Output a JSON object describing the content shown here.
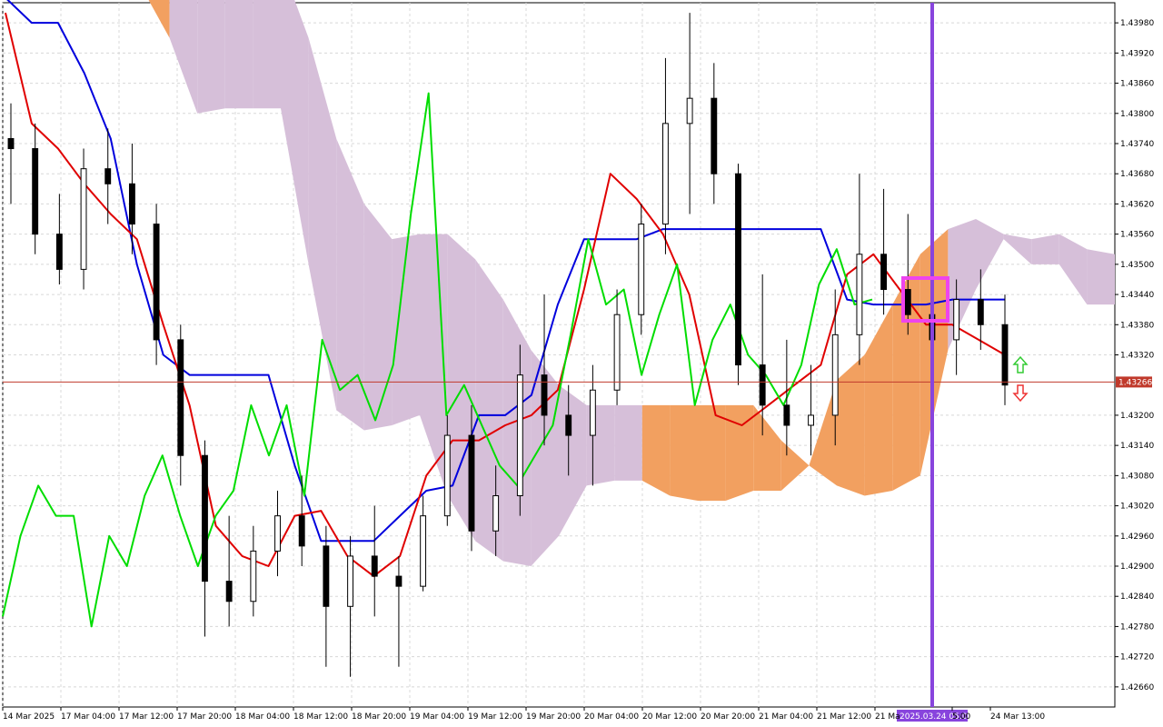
{
  "chart_data": {
    "type": "candlestick",
    "title": "",
    "xlabel": "",
    "ylabel": "",
    "ylim": [
      1.4262,
      1.4402
    ],
    "grid": true,
    "y_ticks": [
      "1.43980",
      "1.43920",
      "1.43860",
      "1.43800",
      "1.43740",
      "1.43680",
      "1.43620",
      "1.43560",
      "1.43500",
      "1.43440",
      "1.43380",
      "1.43320",
      "1.43200",
      "1.43140",
      "1.43080",
      "1.43020",
      "1.42960",
      "1.42900",
      "1.42840",
      "1.42780",
      "1.42720",
      "1.42660"
    ],
    "x_ticks": [
      "14 Mar 2025",
      "17 Mar 04:00",
      "17 Mar 12:00",
      "17 Mar 20:00",
      "18 Mar 04:00",
      "18 Mar 12:00",
      "18 Mar 20:00",
      "19 Mar 04:00",
      "19 Mar 12:00",
      "19 Mar 20:00",
      "20 Mar 04:00",
      "20 Mar 12:00",
      "20 Mar 20:00",
      "21 Mar 04:00",
      "21 Mar 12:00",
      "21 Ma",
      "5:00",
      "24 Mar 13:00"
    ],
    "current_price": "1.43266",
    "current_price_value": 1.43266,
    "vertical_marker_label": "2025.03.24 05:00",
    "colors": {
      "tenkan": "#e00000",
      "kijun": "#0000dd",
      "chikou": "#00dd00",
      "kumo_bear": "#d6bfd9",
      "kumo_bull": "#f2a060",
      "marker": "#8844dd",
      "highlight": "#ee44ee",
      "price_line": "#c0392b",
      "arrow_up": "#33cc33",
      "arrow_down": "#ee3333"
    },
    "candles": [
      {
        "o": 1.4375,
        "h": 1.4382,
        "l": 1.4362,
        "c": 1.4373
      },
      {
        "o": 1.4373,
        "h": 1.4378,
        "l": 1.4352,
        "c": 1.4356
      },
      {
        "o": 1.4356,
        "h": 1.4364,
        "l": 1.4346,
        "c": 1.4349
      },
      {
        "o": 1.4349,
        "h": 1.4373,
        "l": 1.4345,
        "c": 1.4369
      },
      {
        "o": 1.4369,
        "h": 1.4377,
        "l": 1.4358,
        "c": 1.4366
      },
      {
        "o": 1.4366,
        "h": 1.4374,
        "l": 1.4352,
        "c": 1.4358
      },
      {
        "o": 1.4358,
        "h": 1.4362,
        "l": 1.433,
        "c": 1.4335
      },
      {
        "o": 1.4335,
        "h": 1.4338,
        "l": 1.4306,
        "c": 1.4312
      },
      {
        "o": 1.4312,
        "h": 1.4315,
        "l": 1.4276,
        "c": 1.4287
      },
      {
        "o": 1.4287,
        "h": 1.43,
        "l": 1.4278,
        "c": 1.4283
      },
      {
        "o": 1.4283,
        "h": 1.4298,
        "l": 1.428,
        "c": 1.4293
      },
      {
        "o": 1.4293,
        "h": 1.4305,
        "l": 1.4288,
        "c": 1.43
      },
      {
        "o": 1.43,
        "h": 1.4308,
        "l": 1.429,
        "c": 1.4294
      },
      {
        "o": 1.4294,
        "h": 1.4298,
        "l": 1.427,
        "c": 1.4282
      },
      {
        "o": 1.4282,
        "h": 1.4296,
        "l": 1.4268,
        "c": 1.4292
      },
      {
        "o": 1.4292,
        "h": 1.4302,
        "l": 1.428,
        "c": 1.4288
      },
      {
        "o": 1.4288,
        "h": 1.4292,
        "l": 1.427,
        "c": 1.4286
      },
      {
        "o": 1.4286,
        "h": 1.4304,
        "l": 1.4285,
        "c": 1.43
      },
      {
        "o": 1.43,
        "h": 1.432,
        "l": 1.4298,
        "c": 1.4316
      },
      {
        "o": 1.4316,
        "h": 1.4322,
        "l": 1.4293,
        "c": 1.4297
      },
      {
        "o": 1.4297,
        "h": 1.431,
        "l": 1.4292,
        "c": 1.4304
      },
      {
        "o": 1.4304,
        "h": 1.4334,
        "l": 1.43,
        "c": 1.4328
      },
      {
        "o": 1.4328,
        "h": 1.4344,
        "l": 1.4314,
        "c": 1.432
      },
      {
        "o": 1.432,
        "h": 1.4326,
        "l": 1.4308,
        "c": 1.4316
      },
      {
        "o": 1.4316,
        "h": 1.433,
        "l": 1.4306,
        "c": 1.4325
      },
      {
        "o": 1.4325,
        "h": 1.4345,
        "l": 1.4322,
        "c": 1.434
      },
      {
        "o": 1.434,
        "h": 1.4362,
        "l": 1.4336,
        "c": 1.4358
      },
      {
        "o": 1.4358,
        "h": 1.4391,
        "l": 1.4352,
        "c": 1.4378
      },
      {
        "o": 1.4378,
        "h": 1.44,
        "l": 1.436,
        "c": 1.4383
      },
      {
        "o": 1.4383,
        "h": 1.439,
        "l": 1.4362,
        "c": 1.4368
      },
      {
        "o": 1.4368,
        "h": 1.437,
        "l": 1.4326,
        "c": 1.433
      },
      {
        "o": 1.433,
        "h": 1.4348,
        "l": 1.4316,
        "c": 1.4322
      },
      {
        "o": 1.4322,
        "h": 1.4335,
        "l": 1.4312,
        "c": 1.4318
      },
      {
        "o": 1.4318,
        "h": 1.433,
        "l": 1.4312,
        "c": 1.432
      },
      {
        "o": 1.432,
        "h": 1.4345,
        "l": 1.4314,
        "c": 1.4336
      },
      {
        "o": 1.4336,
        "h": 1.4368,
        "l": 1.433,
        "c": 1.4352
      },
      {
        "o": 1.4352,
        "h": 1.4365,
        "l": 1.434,
        "c": 1.4345
      },
      {
        "o": 1.4345,
        "h": 1.436,
        "l": 1.4336,
        "c": 1.434
      },
      {
        "o": 1.434,
        "h": 1.4352,
        "l": 1.433,
        "c": 1.4335
      },
      {
        "o": 1.4335,
        "h": 1.4347,
        "l": 1.4328,
        "c": 1.4343
      },
      {
        "o": 1.4343,
        "h": 1.4349,
        "l": 1.4333,
        "c": 1.4338
      },
      {
        "o": 1.4338,
        "h": 1.4344,
        "l": 1.4322,
        "c": 1.4326
      }
    ],
    "kumo": [
      {
        "x": 0.0,
        "a": 1.441,
        "b": 1.4405
      },
      {
        "x": 0.025,
        "a": 1.441,
        "b": 1.4405
      },
      {
        "x": 0.05,
        "a": 1.441,
        "b": 1.4405
      },
      {
        "x": 0.075,
        "a": 1.441,
        "b": 1.4405
      },
      {
        "x": 0.1,
        "a": 1.441,
        "b": 1.4405
      },
      {
        "x": 0.125,
        "a": 1.441,
        "b": 1.4405
      },
      {
        "x": 0.15,
        "a": 1.441,
        "b": 1.4395
      },
      {
        "x": 0.175,
        "a": 1.441,
        "b": 1.438
      },
      {
        "x": 0.2,
        "a": 1.441,
        "b": 1.4381
      },
      {
        "x": 0.225,
        "a": 1.441,
        "b": 1.4381
      },
      {
        "x": 0.25,
        "a": 1.441,
        "b": 1.4381
      },
      {
        "x": 0.275,
        "a": 1.4395,
        "b": 1.435
      },
      {
        "x": 0.3,
        "a": 1.4375,
        "b": 1.4321
      },
      {
        "x": 0.325,
        "a": 1.4362,
        "b": 1.4317
      },
      {
        "x": 0.35,
        "a": 1.4355,
        "b": 1.4318
      },
      {
        "x": 0.375,
        "a": 1.4356,
        "b": 1.432
      },
      {
        "x": 0.4,
        "a": 1.4356,
        "b": 1.4304
      },
      {
        "x": 0.425,
        "a": 1.4351,
        "b": 1.4295
      },
      {
        "x": 0.45,
        "a": 1.4343,
        "b": 1.4291
      },
      {
        "x": 0.475,
        "a": 1.4333,
        "b": 1.429
      },
      {
        "x": 0.5,
        "a": 1.4326,
        "b": 1.4296
      },
      {
        "x": 0.525,
        "a": 1.4322,
        "b": 1.4306
      },
      {
        "x": 0.55,
        "a": 1.4322,
        "b": 1.4307
      },
      {
        "x": 0.575,
        "a": 1.4322,
        "b": 1.4307
      },
      {
        "x": 0.6,
        "a": 1.4322,
        "b": 1.4304
      },
      {
        "x": 0.625,
        "a": 1.4322,
        "b": 1.4303
      },
      {
        "x": 0.65,
        "a": 1.4322,
        "b": 1.4303
      },
      {
        "x": 0.675,
        "a": 1.4322,
        "b": 1.4305
      },
      {
        "x": 0.7,
        "a": 1.4315,
        "b": 1.4305
      },
      {
        "x": 0.725,
        "a": 1.431,
        "b": 1.431
      },
      {
        "x": 0.75,
        "a": 1.4327,
        "b": 1.4306
      },
      {
        "x": 0.775,
        "a": 1.4332,
        "b": 1.4304
      },
      {
        "x": 0.8,
        "a": 1.4342,
        "b": 1.4305
      },
      {
        "x": 0.825,
        "a": 1.4352,
        "b": 1.4308
      },
      {
        "x": 0.85,
        "a": 1.4357,
        "b": 1.4333
      },
      {
        "x": 0.875,
        "a": 1.4359,
        "b": 1.4345
      },
      {
        "x": 0.9,
        "a": 1.4356,
        "b": 1.4355
      },
      {
        "x": 0.925,
        "a": 1.4355,
        "b": 1.435
      },
      {
        "x": 0.95,
        "a": 1.4356,
        "b": 1.435
      },
      {
        "x": 0.975,
        "a": 1.4353,
        "b": 1.4342
      },
      {
        "x": 1.0,
        "a": 1.4352,
        "b": 1.4342
      }
    ],
    "tenkan": [
      1.44,
      1.4378,
      1.4373,
      1.4366,
      1.436,
      1.4355,
      1.4338,
      1.4322,
      1.4298,
      1.4292,
      1.429,
      1.43,
      1.4301,
      1.4292,
      1.4288,
      1.4292,
      1.4308,
      1.4315,
      1.4315,
      1.4318,
      1.432,
      1.4325,
      1.4345,
      1.4368,
      1.4363,
      1.4356,
      1.4344,
      1.432,
      1.4318,
      1.4322,
      1.4326,
      1.433,
      1.4348,
      1.4352,
      1.4345,
      1.4338,
      1.4338,
      1.4335,
      1.4332
    ],
    "kijun": [
      1.4403,
      1.4398,
      1.4398,
      1.4388,
      1.4375,
      1.435,
      1.4332,
      1.4328,
      1.4328,
      1.4328,
      1.4328,
      1.431,
      1.4295,
      1.4295,
      1.4295,
      1.43,
      1.4305,
      1.4306,
      1.432,
      1.432,
      1.4324,
      1.4342,
      1.4355,
      1.4355,
      1.4355,
      1.4357,
      1.4357,
      1.4357,
      1.4357,
      1.4357,
      1.4357,
      1.4357,
      1.4343,
      1.4342,
      1.4342,
      1.4342,
      1.4343,
      1.4343,
      1.4343
    ],
    "chikou": [
      1.428,
      1.4296,
      1.4306,
      1.43,
      1.43,
      1.4278,
      1.4296,
      1.429,
      1.4304,
      1.4312,
      1.43,
      1.429,
      1.43,
      1.4305,
      1.4322,
      1.4312,
      1.4322,
      1.4304,
      1.4335,
      1.4325,
      1.4328,
      1.4319,
      1.433,
      1.436,
      1.4384,
      1.432,
      1.4326,
      1.4318,
      1.431,
      1.4306,
      1.4312,
      1.4318,
      1.4336,
      1.4355,
      1.4342,
      1.4345,
      1.4328,
      1.434,
      1.435,
      1.4322,
      1.4335,
      1.4342,
      1.4332,
      1.4328,
      1.4322,
      1.433,
      1.4346,
      1.4353,
      1.4342,
      1.4343
    ]
  }
}
